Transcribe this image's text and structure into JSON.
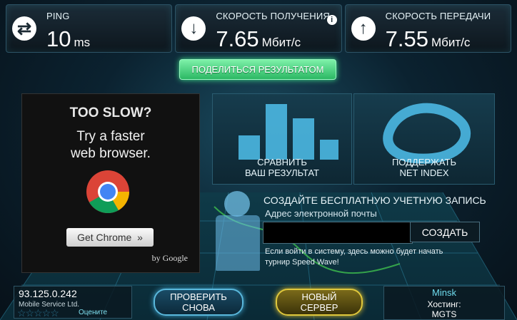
{
  "metrics": {
    "ping": {
      "label": "PING",
      "value": "10",
      "unit": "ms",
      "icon": "swap-arrows-icon"
    },
    "download": {
      "label": "СКОРОСТЬ ПОЛУЧЕНИЯ",
      "value": "7.65",
      "unit": "Мбит/с",
      "icon": "download-arrow-icon"
    },
    "upload": {
      "label": "СКОРОСТЬ ПЕРЕДАЧИ",
      "value": "7.55",
      "unit": "Мбит/с",
      "icon": "upload-arrow-icon"
    },
    "info_glyph": "i"
  },
  "share_label": "ПОДЕЛИТЬСЯ РЕЗУЛЬТАТОМ",
  "ad": {
    "headline": "TOO SLOW?",
    "line1": "Try a faster",
    "line2": "web browser.",
    "button": "Get Chrome",
    "button_chevron": "»",
    "by": "by",
    "brand": "Google"
  },
  "panels": {
    "compare": {
      "line1": "СРАВНИТЬ",
      "line2": "ВАШ РЕЗУЛЬТАТ"
    },
    "support": {
      "line1": "ПОДДЕРЖАТЬ",
      "line2": "NET INDEX"
    }
  },
  "account": {
    "title": "СОЗДАЙТЕ БЕСПЛАТНУЮ УЧЕТНУЮ ЗАПИСЬ",
    "email_label": "Адрес электронной почты",
    "email_value": "",
    "create_label": "СОЗДАТЬ",
    "note_line1": "Если войти в систему, здесь можно будет начать",
    "note_line2": "турнир Speed Wave!"
  },
  "client": {
    "ip": "93.125.0.242",
    "isp": "Mobile Service Ltd.",
    "stars": "☆☆☆☆☆",
    "rate_label": "Оцените"
  },
  "buttons": {
    "again_line1": "ПРОВЕРИТЬ",
    "again_line2": "СНОВА",
    "server_line1": "НОВЫЙ",
    "server_line2": "СЕРВЕР"
  },
  "server": {
    "city": "Minsk",
    "host_label": "Хостинг:",
    "host": "MGTS"
  },
  "colors": {
    "accent_green": "#2bb864",
    "accent_blue": "#5ab8dc",
    "accent_gold": "#e0c83c"
  }
}
